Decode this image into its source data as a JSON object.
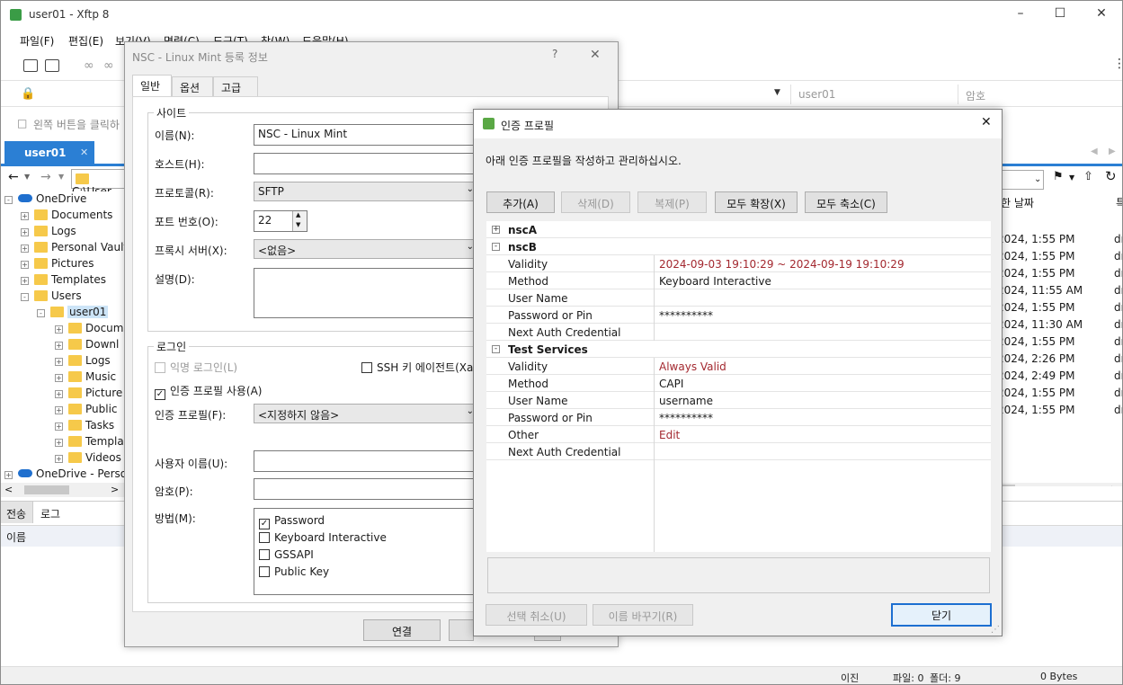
{
  "window": {
    "title": "user01 - Xftp 8"
  },
  "menu": [
    "파일(F)",
    "편집(E)",
    "보기(V)",
    "명령(C)",
    "도구(T)",
    "창(W)",
    "도움말(H)"
  ],
  "address": {
    "user_placeholder": "user01",
    "password_placeholder": "암호"
  },
  "hint": "왼쪽 버튼을 클릭하",
  "session_tab": "user01",
  "path": "C:\\User",
  "tree": {
    "root": "OneDrive",
    "items": [
      "Documents",
      "Logs",
      "Personal Vault",
      "Pictures",
      "Templates",
      "Users"
    ],
    "user": "user01",
    "subitems": [
      "Docum",
      "Downl",
      "Logs",
      "Music",
      "Picture",
      "Public",
      "Tasks",
      "Templa",
      "Videos"
    ],
    "root2": "OneDrive - Persor"
  },
  "right_list": {
    "header": "한 날짜",
    "header2": "특",
    "rows": [
      "2024, 1:55 PM",
      "2024, 1:55 PM",
      "2024, 1:55 PM",
      "2024, 11:55 AM",
      "2024, 1:55 PM",
      "2024, 11:30 AM",
      "2024, 1:55 PM",
      "2024, 2:26 PM",
      "2024, 2:49 PM",
      "2024, 1:55 PM",
      "2024, 1:55 PM"
    ],
    "suffix": "dr"
  },
  "bottom": {
    "tab_transfer": "전송",
    "tab_log": "로그",
    "col_name": "이름"
  },
  "status": {
    "transfer": "이진",
    "files": "파일: 0",
    "folders": "폴더: 9",
    "bytes": "0 Bytes"
  },
  "dialog1": {
    "title": "NSC - Linux Mint 등록 정보",
    "help": "?",
    "tabs": [
      "일반",
      "옵션",
      "고급"
    ],
    "site_group": "사이트",
    "name_label": "이름(N):",
    "name_value": "NSC - Linux Mint",
    "host_label": "호스트(H):",
    "host_value": "",
    "protocol_label": "프로토콜(R):",
    "protocol_value": "SFTP",
    "port_label": "포트 번호(O):",
    "port_value": "22",
    "proxy_label": "프록시 서버(X):",
    "proxy_value": "<없음>",
    "desc_label": "설명(D):",
    "login_group": "로그인",
    "anon_login": "익명 로그인(L)",
    "ssh_agent": "SSH 키 에이전트(Xag",
    "use_auth_profile": "인증 프로필 사용(A)",
    "auth_profile_label": "인증 프로필(F):",
    "auth_profile_value": "<지정하지 않음>",
    "user_label": "사용자 이름(U):",
    "password_label": "암호(P):",
    "method_label": "방법(M):",
    "methods": [
      {
        "label": "Password",
        "checked": true
      },
      {
        "label": "Keyboard Interactive",
        "checked": false
      },
      {
        "label": "GSSAPI",
        "checked": false
      },
      {
        "label": "Public Key",
        "checked": false
      }
    ],
    "connect_button": "연결"
  },
  "dialog2": {
    "title": "인증 프로필",
    "description": "아래 인증 프로필을 작성하고 관리하십시오.",
    "buttons": {
      "add": "추가(A)",
      "delete": "삭제(D)",
      "copy": "복제(P)",
      "expand_all": "모두 확장(X)",
      "collapse_all": "모두 축소(C)"
    },
    "profiles": [
      {
        "name": "nscA",
        "expanded": false,
        "rows": []
      },
      {
        "name": "nscB",
        "expanded": true,
        "rows": [
          {
            "key": "Validity",
            "value": "2024-09-03 19:10:29 ~ 2024-09-19 19:10:29",
            "red": true
          },
          {
            "key": "Method",
            "value": "Keyboard Interactive",
            "red": false
          },
          {
            "key": "User Name",
            "value": "",
            "red": false
          },
          {
            "key": "Password or Pin",
            "value": "**********",
            "red": false
          },
          {
            "key": "Next Auth Credential",
            "value": "",
            "red": false
          }
        ]
      },
      {
        "name": "Test Services",
        "expanded": true,
        "rows": [
          {
            "key": "Validity",
            "value": "Always Valid",
            "red": true
          },
          {
            "key": "Method",
            "value": "CAPI",
            "red": false
          },
          {
            "key": "User Name",
            "value": "username",
            "red": false
          },
          {
            "key": "Password or Pin",
            "value": "**********",
            "red": false
          },
          {
            "key": "Other",
            "value": "Edit",
            "red": true
          },
          {
            "key": "Next Auth Credential",
            "value": "",
            "red": false
          }
        ]
      }
    ],
    "bottom_buttons": {
      "deselect": "선택 취소(U)",
      "rename": "이름 바꾸기(R)",
      "close": "닫기"
    }
  },
  "colors": {
    "accent": "#2b7fd4",
    "red_text": "#a3282f"
  }
}
